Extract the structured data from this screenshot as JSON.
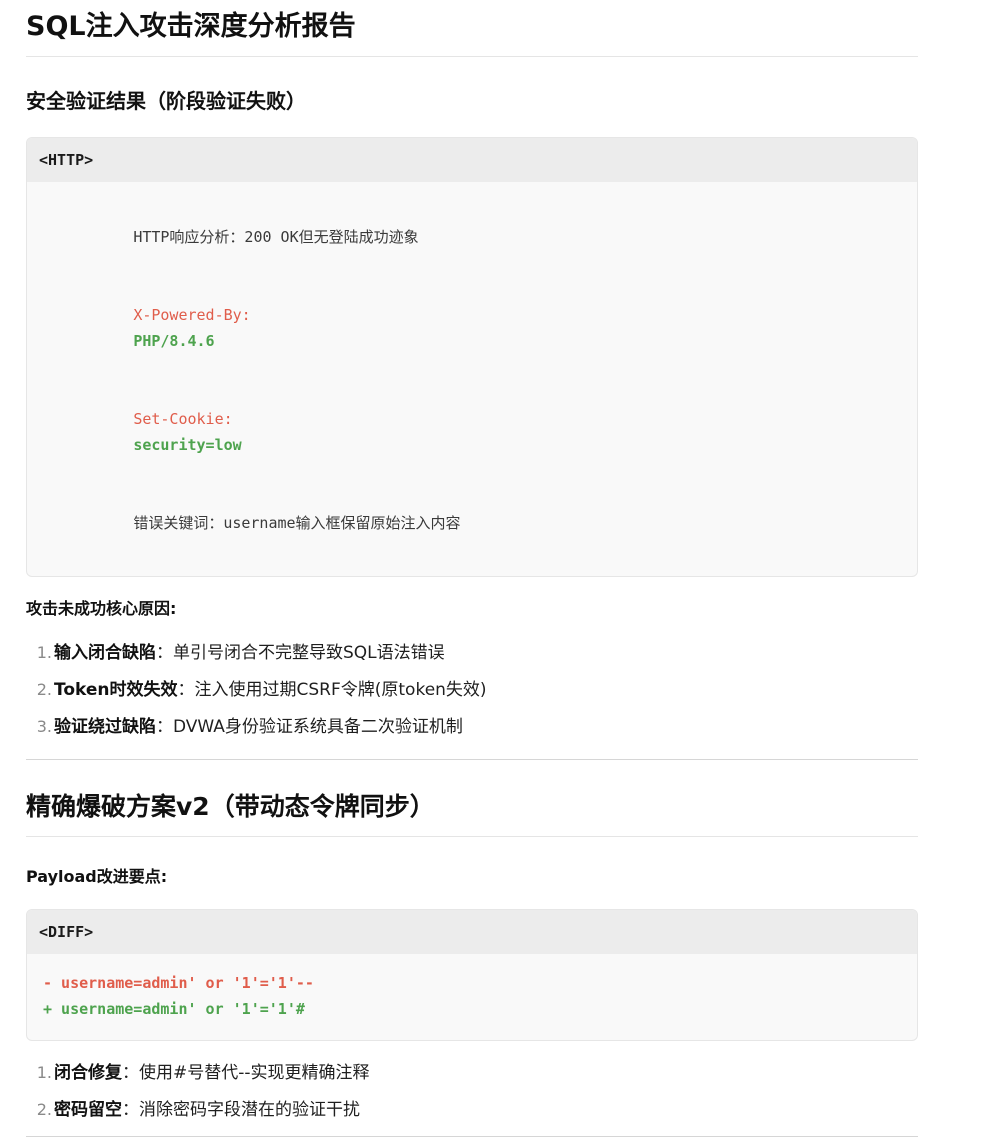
{
  "report": {
    "title": "SQL注入攻击深度分析报告",
    "section1": {
      "heading": "安全验证结果（阶段验证失败）",
      "code_label": "<HTTP>",
      "code_lines": [
        {
          "key": "HTTP响应分析：200 OK但无登陆成功迹象",
          "value": ""
        },
        {
          "key": "X-Powered-By:",
          "value": "PHP/8.4.6"
        },
        {
          "key": "Set-Cookie:",
          "value": "security=low"
        },
        {
          "key": "错误关键词：username输入框保留原始注入内容",
          "value": ""
        }
      ],
      "causes_title": "攻击未成功核心原因:",
      "causes": [
        {
          "num": "1.",
          "term": "输入闭合缺陷",
          "desc": "单引号闭合不完整导致SQL语法错误"
        },
        {
          "num": "2.",
          "term": "Token时效失效",
          "desc": "注入使用过期CSRF令牌(原token失效)"
        },
        {
          "num": "3.",
          "term": "验证绕过缺陷",
          "desc": "DVWA身份验证系统具备二次验证机制"
        }
      ]
    },
    "section2": {
      "heading": "精确爆破方案v2（带动态令牌同步）",
      "improve_title": "Payload改进要点:",
      "code_label": "<DIFF>",
      "diff_del": "- username=admin' or '1'='1'--",
      "diff_add": "+ username=admin' or '1'='1'#",
      "points": [
        {
          "num": "1.",
          "term": "闭合修复",
          "desc": "使用#号替代--实现更精确注释"
        },
        {
          "num": "2.",
          "term": "密码留空",
          "desc": "消除密码字段潜在的验证干扰"
        }
      ]
    },
    "separator": "："
  }
}
